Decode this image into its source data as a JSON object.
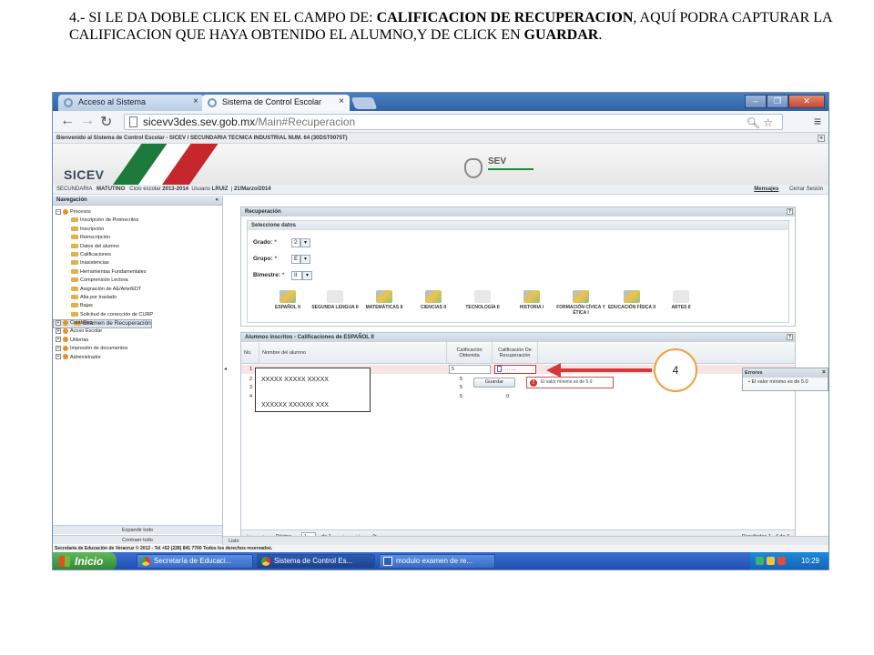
{
  "instruction": {
    "prefix": "4.- SI LE DA DOBLE CLICK EN EL CAMPO DE: ",
    "field_bold": "CALIFICACION DE RECUPERACION",
    "middle": ", AQUÍ PODRA CAPTURAR LA CALIFICACION QUE HAYA OBTENIDO EL ALUMNO,Y DE CLICK EN ",
    "save_bold": "GUARDAR",
    "suffix": "."
  },
  "browser": {
    "tab1": "Acceso al Sistema",
    "tab2": "Sistema de Control Escolar",
    "url_host": "sicevv3des.sev.gob.mx",
    "url_path": "/Main#Recuperacion"
  },
  "app": {
    "welcome": "Bienvenido al Sistema de Control Escolar - SICEV / SECUNDARIA TECNICA INDUSTRIAL NUM. 64 (30DST0075T)",
    "logo_text": "SICEV",
    "sev_text": "SEV",
    "info": {
      "level": "SECUNDARIA",
      "shift": "MATUTINO",
      "cycle_label": "Ciclo escolar",
      "cycle": "2013-2014",
      "user_label": "Usuario",
      "user": "LRUIZ",
      "date": "21/Marzo/2014",
      "messages": "Mensajes",
      "logout": "Cerrar Sesión"
    }
  },
  "sidebar": {
    "title": "Navegación",
    "procesos": "Procesos",
    "items": [
      "Inscripción de Preinscritos",
      "Inscripción",
      "Reinscripción",
      "Datos del alumno",
      "Calificaciones",
      "Inasistencias",
      "Herramientas Fundamentales",
      "Comprensión Lectora",
      "Asignación de AE/Arte/EDT",
      "Alta por traslado",
      "Bajas",
      "Solicitud de corrección de CURP",
      "Examen de Recuperación"
    ],
    "groups": [
      "Catálogos",
      "Acoso Escolar",
      "Utilerías",
      "Impresión de documentos",
      "Administrador"
    ],
    "expand": "Expandir todo",
    "collapse": "Contraer todo"
  },
  "recuperacion": {
    "title": "Recuperación",
    "select_title": "Seleccione datos",
    "grado_label": "Grado:",
    "grado_value": "2",
    "grupo_label": "Grupo:",
    "grupo_value": "E",
    "bimestre_label": "Bimestre:",
    "bimestre_value": "II",
    "subjects": [
      {
        "name": "ESPAÑOL II",
        "icon": "chart-icon"
      },
      {
        "name": "SEGUNDA LENGUA II",
        "icon": "blank-icon"
      },
      {
        "name": "MATEMÁTICAS II",
        "icon": "chart-icon"
      },
      {
        "name": "CIENCIAS II",
        "icon": "chart-icon"
      },
      {
        "name": "TECNOLOGÍA II",
        "icon": "blank-icon"
      },
      {
        "name": "HISTORIA I",
        "icon": "chart-icon"
      },
      {
        "name": "FORMACIÓN CÍVICA Y ÉTICA I",
        "icon": "chart-icon"
      },
      {
        "name": "EDUCACIÓN FÍSICA II",
        "icon": "chart-icon"
      },
      {
        "name": "ARTES II",
        "icon": "blank-icon"
      }
    ]
  },
  "grid": {
    "title": "Alumnos inscritos - Calificaciones de ESPAÑOL II",
    "col_no": "No.",
    "col_name": "Nombre del alumno",
    "col_grade": "Calificación Obtenida",
    "col_recovery": "Calificación De Recuperación",
    "rows": [
      {
        "no": "1",
        "grade": "5",
        "recovery": ""
      },
      {
        "no": "2",
        "grade": "5",
        "recovery": ""
      },
      {
        "no": "3",
        "grade": "5",
        "recovery": ""
      },
      {
        "no": "4",
        "grade": "5",
        "recovery": "0"
      }
    ],
    "save": "Guardar",
    "tooltip": "El valor mínimo es de 5.0",
    "pager": {
      "page_label": "Página",
      "page": "1",
      "of": "de 1",
      "results": "Resultados 1 - 4 de 4"
    }
  },
  "errors": {
    "title": "Errores",
    "item": "El valor mínimo es de 5.0"
  },
  "lista": "Listo",
  "footer": "Secretaría de Educación de Veracruz © 2012 - Tel +52 (228) 841 7700 Todos los derechos reservados.",
  "taskbar": {
    "start": "Inicio",
    "items": [
      "Secretaría de Educaci...",
      "Sistema de Control Es...",
      "modulo examen de re..."
    ],
    "time": "10:29"
  },
  "overlay": {
    "name1": "XXXXX XXXXX XXXXX",
    "name2": "XXXXXX XXXXXX XXX",
    "step": "4",
    "arrow_color": "#d9383a",
    "badge_color": "#f0a03c"
  }
}
